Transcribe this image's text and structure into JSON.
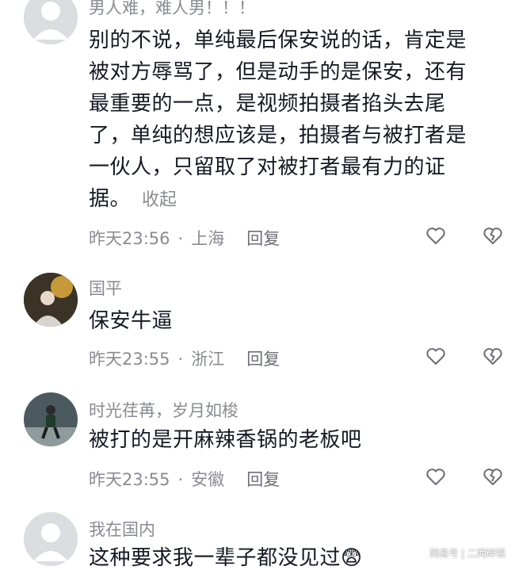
{
  "comments": [
    {
      "name": "男人难，难人男！！！",
      "lines": [
        "别的不说，单纯最后保安说的话，肯定是",
        "被对方辱骂了，但是动手的是保安，还有",
        "最重要的一点，是视频拍摄者掐头去尾",
        "了，单纯的想应该是，拍摄者与被打者是",
        "一伙人，只留取了对被打者最有力的证",
        "据。"
      ],
      "collapse": "收起",
      "time": "昨天23:56",
      "location": "上海",
      "reply": "回复"
    },
    {
      "name": "国平",
      "lines": [
        "保安牛逼"
      ],
      "time": "昨天23:55",
      "location": "浙江",
      "reply": "回复"
    },
    {
      "name": "时光荏苒，岁月如梭",
      "lines": [
        "被打的是开麻辣香锅的老板吧"
      ],
      "time": "昨天23:55",
      "location": "安徽",
      "reply": "回复"
    },
    {
      "name": "我在国内",
      "lines": [
        "这种要求我一辈子都没见过😨"
      ]
    }
  ],
  "separator": "·",
  "watermark": "网易号 | 二两碎银",
  "icons": {
    "like": "heart-outline-icon",
    "dislike": "broken-heart-icon"
  }
}
